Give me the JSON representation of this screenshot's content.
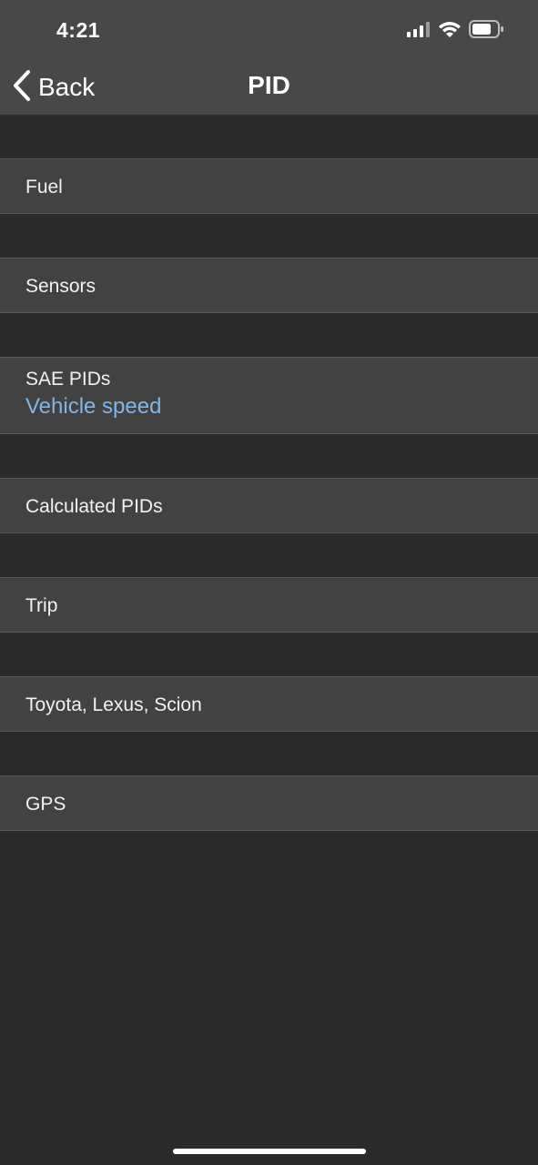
{
  "status_bar": {
    "time": "4:21",
    "signal_icon": "cellular-signal-icon",
    "wifi_icon": "wifi-icon",
    "battery_icon": "battery-icon"
  },
  "nav": {
    "back_label": "Back",
    "back_icon": "chevron-left-icon",
    "title": "PID"
  },
  "rows": [
    {
      "label": "Fuel"
    },
    {
      "label": "Sensors"
    },
    {
      "label": "SAE PIDs",
      "sublabel": "Vehicle speed"
    },
    {
      "label": "Calculated PIDs"
    },
    {
      "label": "Trip"
    },
    {
      "label": "Toyota, Lexus, Scion"
    },
    {
      "label": "GPS"
    }
  ],
  "colors": {
    "background": "#2a2a2a",
    "bar": "#484848",
    "row": "#424242",
    "accent": "#7fb6ea"
  }
}
